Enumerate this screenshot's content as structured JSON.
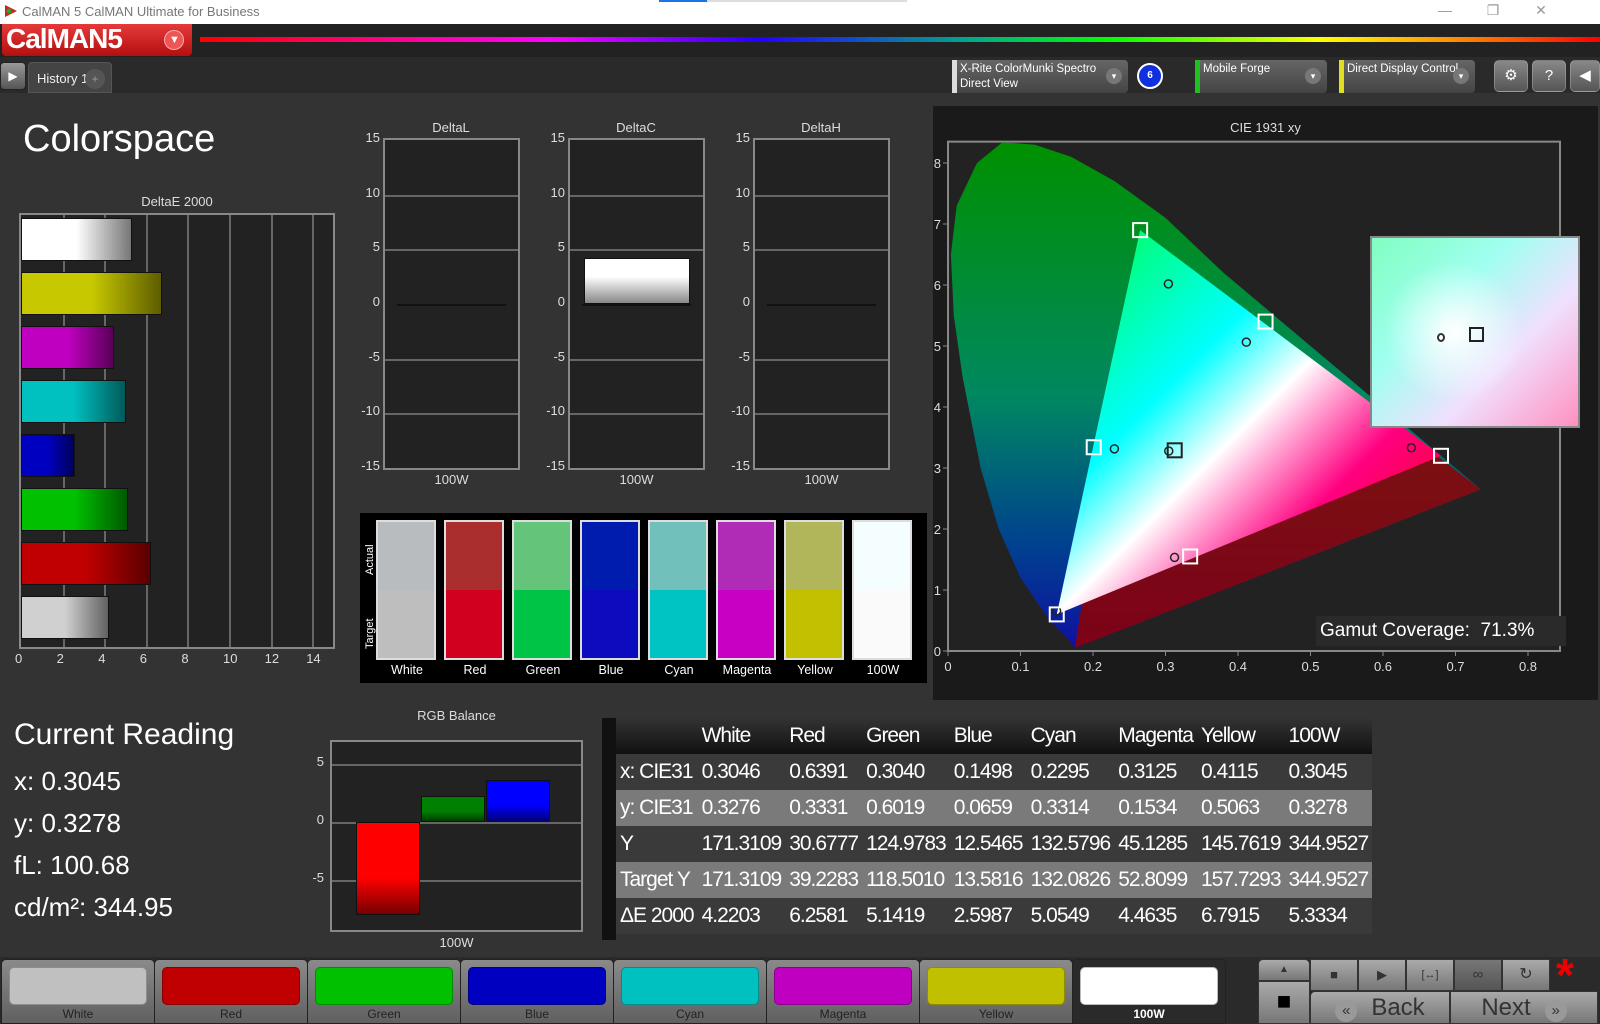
{
  "window": {
    "title": "CalMAN 5 CalMAN Ultimate for Business",
    "logo": "CalMAN5",
    "min_icon": "—",
    "restore_icon": "❐",
    "close_icon": "✕"
  },
  "tabs": {
    "play_icon": "▶",
    "items": [
      {
        "label": "History 1"
      }
    ],
    "add_icon": "+"
  },
  "devices": {
    "meter": {
      "line1": "X-Rite ColorMunki Spectro",
      "line2": "Direct View",
      "stripe": "#dddddd",
      "badge": "6"
    },
    "source": {
      "line1": "Mobile Forge",
      "stripe": "#20c020"
    },
    "display": {
      "line1": "Direct Display Control",
      "stripe": "#e0e020"
    },
    "settings_icon": "⚙",
    "help_icon": "?",
    "collapse_icon": "◀",
    "dropdown_icon": "▾"
  },
  "page": {
    "title": "Colorspace"
  },
  "chart_data": [
    {
      "type": "bar",
      "orientation": "horizontal",
      "title": "DeltaE 2000",
      "categories": [
        "White",
        "Yellow",
        "Magenta",
        "Cyan",
        "Blue",
        "Green",
        "Red",
        "White"
      ],
      "values": [
        5.33,
        6.79,
        4.46,
        5.05,
        2.6,
        5.14,
        6.26,
        4.22
      ],
      "colors": [
        "#ffffff",
        "#c8c800",
        "#c000c0",
        "#00c0c0",
        "#0000c0",
        "#00c000",
        "#c00000",
        "#d0d0d0"
      ],
      "xlim": [
        0,
        15
      ],
      "xticks": [
        "0",
        "2",
        "4",
        "6",
        "8",
        "10",
        "12",
        "14"
      ],
      "grid": true
    },
    {
      "type": "bar",
      "title": "DeltaL",
      "categories": [
        "100W"
      ],
      "values": [
        0
      ],
      "ylim": [
        -15,
        15
      ],
      "yticks": [
        "15",
        "10",
        "5",
        "0",
        "-5",
        "-10",
        "-15"
      ]
    },
    {
      "type": "bar",
      "title": "DeltaC",
      "categories": [
        "100W"
      ],
      "values": [
        4.2
      ],
      "ylim": [
        -15,
        15
      ],
      "yticks": [
        "15",
        "10",
        "5",
        "0",
        "-5",
        "-10",
        "-15"
      ]
    },
    {
      "type": "bar",
      "title": "DeltaH",
      "categories": [
        "100W"
      ],
      "values": [
        0
      ],
      "ylim": [
        -15,
        15
      ],
      "yticks": [
        "15",
        "10",
        "5",
        "0",
        "-5",
        "-10",
        "-15"
      ]
    },
    {
      "type": "scatter",
      "title": "CIE 1931 xy",
      "xlim": [
        0,
        0.8
      ],
      "ylim": [
        0,
        0.85
      ],
      "xticks": [
        "0",
        "0.1",
        "0.2",
        "0.3",
        "0.4",
        "0.5",
        "0.6",
        "0.7",
        "0.8"
      ],
      "yticks": [
        "0",
        "0.1",
        "0.2",
        "0.3",
        "0.4",
        "0.5",
        "0.6",
        "0.7",
        "0.8"
      ],
      "targets": [
        {
          "name": "Red",
          "x": 0.68,
          "y": 0.32
        },
        {
          "name": "Green",
          "x": 0.265,
          "y": 0.69
        },
        {
          "name": "Blue",
          "x": 0.15,
          "y": 0.06
        },
        {
          "name": "Cyan",
          "x": 0.201,
          "y": 0.334
        },
        {
          "name": "Magenta",
          "x": 0.334,
          "y": 0.155
        },
        {
          "name": "Yellow",
          "x": 0.438,
          "y": 0.54
        },
        {
          "name": "White",
          "x": 0.3127,
          "y": 0.329
        }
      ],
      "actuals": [
        {
          "name": "Red",
          "x": 0.6391,
          "y": 0.3331
        },
        {
          "name": "Green",
          "x": 0.304,
          "y": 0.6019
        },
        {
          "name": "Blue",
          "x": 0.1498,
          "y": 0.0659
        },
        {
          "name": "Cyan",
          "x": 0.2295,
          "y": 0.3314
        },
        {
          "name": "Magenta",
          "x": 0.3125,
          "y": 0.1534
        },
        {
          "name": "Yellow",
          "x": 0.4115,
          "y": 0.5063
        },
        {
          "name": "White",
          "x": 0.3045,
          "y": 0.3278
        }
      ],
      "annotation": {
        "label": "Gamut Coverage:",
        "value": "71.3%"
      }
    },
    {
      "type": "bar",
      "title": "RGB Balance",
      "categories": [
        "100W"
      ],
      "series": [
        {
          "name": "Red",
          "value": -8.0,
          "color": "#ff0000"
        },
        {
          "name": "Green",
          "value": 2.2,
          "color": "#008000"
        },
        {
          "name": "Blue",
          "value": 3.6,
          "color": "#0000ff"
        }
      ],
      "ylim": [
        -8,
        8
      ],
      "yticks": [
        "5",
        "0",
        "-5"
      ]
    }
  ],
  "swatches": {
    "actual_label": "Actual",
    "target_label": "Target",
    "items": [
      {
        "name": "White",
        "actual": "#b8bcbe",
        "target": "#bebebe"
      },
      {
        "name": "Red",
        "actual": "#aa2e2e",
        "target": "#d0001e"
      },
      {
        "name": "Green",
        "actual": "#64c47a",
        "target": "#00c446"
      },
      {
        "name": "Blue",
        "actual": "#001cae",
        "target": "#0c0cbe"
      },
      {
        "name": "Cyan",
        "actual": "#72c0bc",
        "target": "#00c4c4"
      },
      {
        "name": "Magenta",
        "actual": "#b02cb6",
        "target": "#c800c4"
      },
      {
        "name": "Yellow",
        "actual": "#b2b65a",
        "target": "#c2c000"
      },
      {
        "name": "100W",
        "actual": "#f4feff",
        "target": "#fafafa"
      }
    ]
  },
  "reading": {
    "title": "Current Reading",
    "x": "x: 0.3045",
    "y": "y: 0.3278",
    "fl": "fL: 100.68",
    "cd": "cd/m²: 344.95"
  },
  "table": {
    "columns": [
      "",
      "White",
      "Red",
      "Green",
      "Blue",
      "Cyan",
      "Magenta",
      "Yellow",
      "100W"
    ],
    "rows": [
      [
        "x: CIE31",
        "0.3046",
        "0.6391",
        "0.3040",
        "0.1498",
        "0.2295",
        "0.3125",
        "0.4115",
        "0.3045"
      ],
      [
        "y: CIE31",
        "0.3276",
        "0.3331",
        "0.6019",
        "0.0659",
        "0.3314",
        "0.1534",
        "0.5063",
        "0.3278"
      ],
      [
        "Y",
        "171.3109",
        "30.6777",
        "124.9783",
        "12.5465",
        "132.5796",
        "45.1285",
        "145.7619",
        "344.9527"
      ],
      [
        "Target Y",
        "171.3109",
        "39.2283",
        "118.5010",
        "13.5816",
        "132.0826",
        "52.8099",
        "157.7293",
        "344.9527"
      ],
      [
        "ΔE 2000",
        "4.2203",
        "6.2581",
        "5.1419",
        "2.5987",
        "5.0549",
        "4.4635",
        "6.7915",
        "5.3334"
      ]
    ]
  },
  "patches": {
    "items": [
      {
        "label": "White",
        "color": "#c0c0c0"
      },
      {
        "label": "Red",
        "color": "#c00000"
      },
      {
        "label": "Green",
        "color": "#00c000"
      },
      {
        "label": "Blue",
        "color": "#0000c0"
      },
      {
        "label": "Cyan",
        "color": "#00c0c0"
      },
      {
        "label": "Magenta",
        "color": "#c000c0"
      },
      {
        "label": "Yellow",
        "color": "#c0c000"
      },
      {
        "label": "100W",
        "color": "#ffffff"
      }
    ],
    "selected": 7
  },
  "controls": {
    "up_icon": "▲",
    "stop_square_icon": "■",
    "stop_icon": "■",
    "play_icon": "▶",
    "fit_icon": "[↔]",
    "loop_icon": "∞",
    "refresh_icon": "↻",
    "asterisk": "*",
    "back_label": "Back",
    "back_icon": "«",
    "next_label": "Next",
    "next_icon": "»"
  }
}
